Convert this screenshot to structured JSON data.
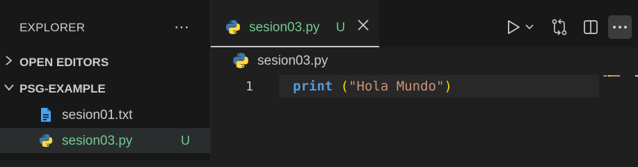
{
  "explorer": {
    "title": "EXPLORER",
    "more_icon": "ellipsis-icon",
    "sections": {
      "open_editors": "OPEN EDITORS",
      "workspace": "PSG-EXAMPLE"
    },
    "files": [
      {
        "name": "sesion01.txt",
        "icon": "text-file-icon",
        "status": ""
      },
      {
        "name": "sesion03.py",
        "icon": "python-file-icon",
        "status": "U"
      }
    ]
  },
  "tab": {
    "name": "sesion03.py",
    "status": "U",
    "icon": "python-file-icon"
  },
  "actions": [
    "run-icon",
    "chevron-down-icon",
    "compare-changes-icon",
    "split-editor-icon",
    "ellipsis-icon"
  ],
  "breadcrumb": {
    "file": "sesion03.py"
  },
  "code": {
    "line_number": "1",
    "keyword": "print",
    "space": " ",
    "paren_open": "(",
    "string": "\"Hola Mundo\"",
    "paren_close": ")"
  },
  "colors": {
    "untracked": "#73c991",
    "keyword": "#569cd6",
    "string": "#ce9178",
    "bracket": "#ffd700",
    "python_blue": "#3c78aa",
    "python_yellow": "#ffd845",
    "text_file": "#42a5f5"
  }
}
